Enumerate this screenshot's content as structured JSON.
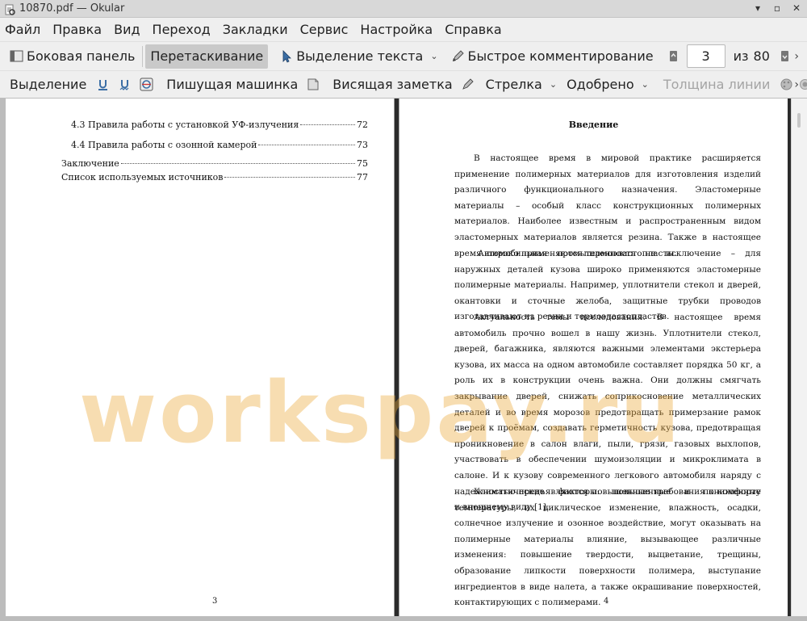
{
  "window": {
    "title": "10870.pdf  — Okular"
  },
  "menu": [
    "Файл",
    "Правка",
    "Вид",
    "Переход",
    "Закладки",
    "Сервис",
    "Настройка",
    "Справка"
  ],
  "toolbar1": {
    "sidebar": "Боковая панель",
    "drag": "Перетаскивание",
    "text_select": "Выделение текста",
    "quick_comment": "Быстрое комментирование",
    "page_current": "3",
    "page_of": "из",
    "page_total": "80"
  },
  "toolbar2": {
    "select": "Выделение",
    "typewriter": "Пишущая машинка",
    "sticky_note": "Висящая заметка",
    "arrow": "Стрелка",
    "stamp": "Одобрено",
    "line_width": "Толщина линии"
  },
  "page_left": {
    "toc": [
      {
        "text": "4.3 Правила работы с установкой УФ-излучения",
        "page": "72"
      },
      {
        "text": "4.4 Правила работы с озонной камерой",
        "page": "73"
      },
      {
        "text": "Заключение",
        "page": "75"
      },
      {
        "text": "Список используемых источников",
        "page": "77"
      }
    ],
    "number": "3"
  },
  "page_right": {
    "heading": "Введение",
    "paragraphs": [
      "В настоящее время в мировой практике расширяется применение полимерных материалов для изготовления изделий различного функционального назначения. Эластомерные материалы – особый класс конструкционных полимерных материалов. Наиболее известным и распространенным видом эластомерных материалов является резина. Также в настоящее время широко применяются термоэластопласты.",
      "Автомобильная промышленность не исключение – для наружных деталей кузова широко применяются эластомерные полимерные материалы. Например, уплотнители стекол и дверей, окантовки и сточные желоба, защитные трубки проводов изготавливают из резин и термоэластопластов.",
      "Актуальность темы исследования. В настоящее время автомобиль прочно вошел в нашу жизнь. Уплотнители стекол, дверей, багажника, являются важными элементами экстерьера кузова, их масса на одном автомобиле составляет порядка 50 кг, а роль их в конструкции очень важна. Они должны смягчать закрывание дверей, снижать соприкосновение металлических деталей и во время морозов предотвращать примерзание рамок дверей к проёмам, создавать герметичность кузова, предотвращая проникновение в салон влаги, пыли, грязи, газовых выхлопов, участвовать в обеспечении шумоизоляции и микроклимата в салоне. И к кузову современного легкового автомобиля наряду с надежностью предъявляются повышенные требования к комфорту и внешнему виду [1].",
      "Климатические факторы: повышенные и пониженные температуры, их циклическое изменение, влажность, осадки, солнечное излучение и озонное воздействие, могут оказывать на полимерные материалы влияние, вызывающее различные изменения: повышение твердости, выцветание, трещины, образование липкости поверхности полимера, выступание ингредиентов в виде налета, а также окрашивание поверхностей, контактирующих с полимерами."
    ],
    "number": "4"
  },
  "watermark": "workspay.ru"
}
